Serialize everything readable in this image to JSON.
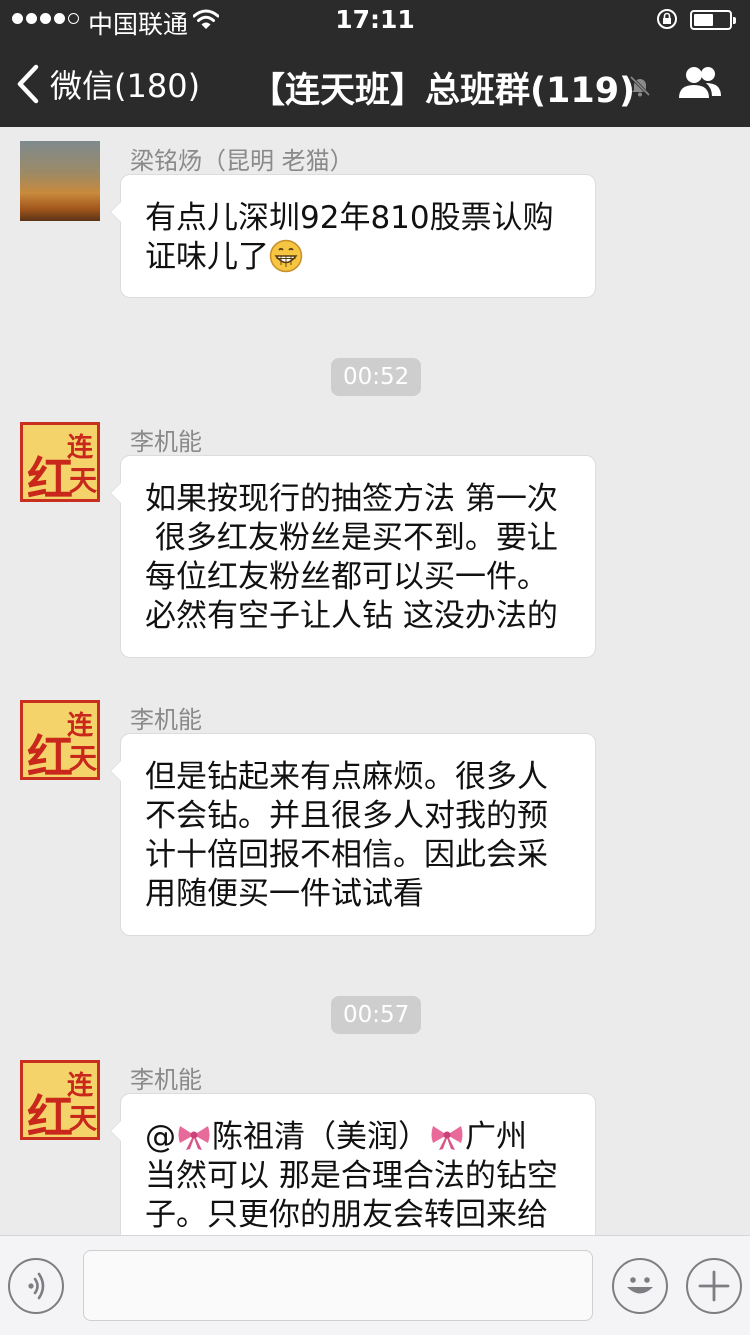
{
  "status_bar": {
    "carrier": "中国联通",
    "time": "17:11",
    "battery_level": 0.55
  },
  "nav": {
    "back_label": "微信(180)",
    "title": "【连天班】总班群(119)",
    "muted": true
  },
  "messages": [
    {
      "sender": "梁铭炀（昆明 老猫）",
      "avatar": "landscape-photo",
      "lines": [
        "有点儿深圳92年810股票认购",
        "证味儿了"
      ],
      "trailing_emoji": "grinning-face"
    },
    {
      "timestamp": "00:52"
    },
    {
      "sender": "李机能",
      "avatar": "red-seal-logo",
      "lines": [
        "如果按现行的抽签方法 第一次",
        " 很多红友粉丝是买不到。要让",
        "每位红友粉丝都可以买一件。",
        "必然有空子让人钻 这没办法的"
      ]
    },
    {
      "sender": "李机能",
      "avatar": "red-seal-logo",
      "lines": [
        "但是钻起来有点麻烦。很多人",
        "不会钻。并且很多人对我的预",
        "计十倍回报不相信。因此会采",
        "用随便买一件试试看"
      ]
    },
    {
      "timestamp": "00:57"
    },
    {
      "sender": "李机能",
      "avatar": "red-seal-logo",
      "lines_rich": {
        "at": "@",
        "name": "陈祖清（美润）",
        "city": "广州"
      },
      "lines": [
        "当然可以 那是合理合法的钻空",
        "子。只更你的朋友会转回来给"
      ]
    }
  ],
  "input_bar": {
    "placeholder": ""
  },
  "colors": {
    "nav_bg": "#2b2b2b",
    "chat_bg": "#ebebeb",
    "timestamp_bg": "#cecece",
    "seal_red": "#c92f1f",
    "seal_gold": "#f4d46a"
  }
}
